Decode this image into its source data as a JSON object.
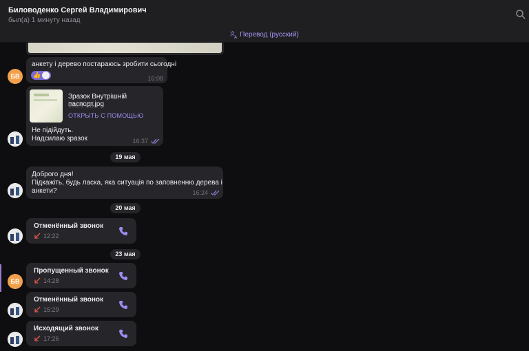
{
  "header": {
    "contact_name": "Биловоденко Сергей Владимирович",
    "last_seen": "был(а) 1 минуту назад",
    "translate_label": "Перевод (русский)"
  },
  "colors": {
    "accent": "#9d8bf0",
    "missed_arrow": "#e0584f",
    "avatar_initials_bg": "#f3a04c"
  },
  "messages": {
    "m1": {
      "avatar": "БВ",
      "text": "анкету і дерево постараюсь зробити сьогодні",
      "time": "16:08",
      "reaction": "👍"
    },
    "m2": {
      "file_name": "Зразок Внутрішній паспорт.jpg",
      "file_size": "955.9 KB",
      "open_label": "ОТКРЫТЬ С ПОМОЩЬЮ",
      "line1": "Не підійдуть.",
      "line2": "Надсилаю зразок",
      "time": "16:37"
    },
    "date1": "19 мая",
    "m3": {
      "line1": "Доброго дня!",
      "line2": "Підкажіть, будь ласка, яка ситуація по заповненню дерева  і",
      "line3": "анкети?",
      "time": "16:24"
    },
    "date2": "20 мая",
    "c1": {
      "title": "Отменённый звонок",
      "time": "12:22"
    },
    "date3": "23 мая",
    "c2": {
      "avatar": "БВ",
      "title": "Пропущенный звонок",
      "time": "14:28"
    },
    "c3": {
      "title": "Отменённый звонок",
      "time": "15:29"
    },
    "c4": {
      "title": "Исходящий звонок",
      "time": "17:26"
    }
  }
}
